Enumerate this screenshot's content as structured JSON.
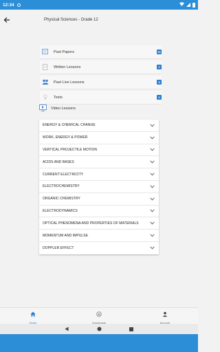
{
  "status_bar": {
    "time": "12:34"
  },
  "header": {
    "title": "Physical Sciences - Grade 12"
  },
  "quick_links": [
    {
      "label": "Past Papers",
      "icon": "past-papers-icon",
      "badge": "96"
    },
    {
      "label": "Written Lessons",
      "icon": "written-lessons-icon",
      "badge": "2"
    },
    {
      "label": "Past Live Lessons",
      "icon": "live-lessons-icon",
      "badge": "8"
    },
    {
      "label": "Tests",
      "icon": "tests-icon",
      "badge": "0"
    }
  ],
  "video_lessons": {
    "label": "Video Lessons",
    "icon": "video-lessons-icon"
  },
  "topics": [
    {
      "label": "ENERGY & CHEMICAL CHANGE"
    },
    {
      "label": "WORK, ENERGY & POWER"
    },
    {
      "label": "VERTICAL PROJECTILE MOTION"
    },
    {
      "label": "ACIDS AND BASES"
    },
    {
      "label": "CURRENT ELECTRICITY"
    },
    {
      "label": "ELECTROCHEMISTRY"
    },
    {
      "label": "ORGANIC CHEMISTRY"
    },
    {
      "label": "ELECTRODYNAMICS"
    },
    {
      "label": "OPTICAL PHENOMENA AND PROPERTIES OF MATERIALS"
    },
    {
      "label": "MOMENTUM AND IMPULSE"
    },
    {
      "label": "DOPPLER EFFECT"
    }
  ],
  "bottom_nav": [
    {
      "label": "Home",
      "icon": "home-icon",
      "active": true
    },
    {
      "label": "Downloads",
      "icon": "downloads-icon",
      "active": false
    },
    {
      "label": "Account",
      "icon": "account-icon",
      "active": false
    }
  ],
  "colors": {
    "accent": "#2b7ed0",
    "status_bar": "#2b8ed6"
  }
}
